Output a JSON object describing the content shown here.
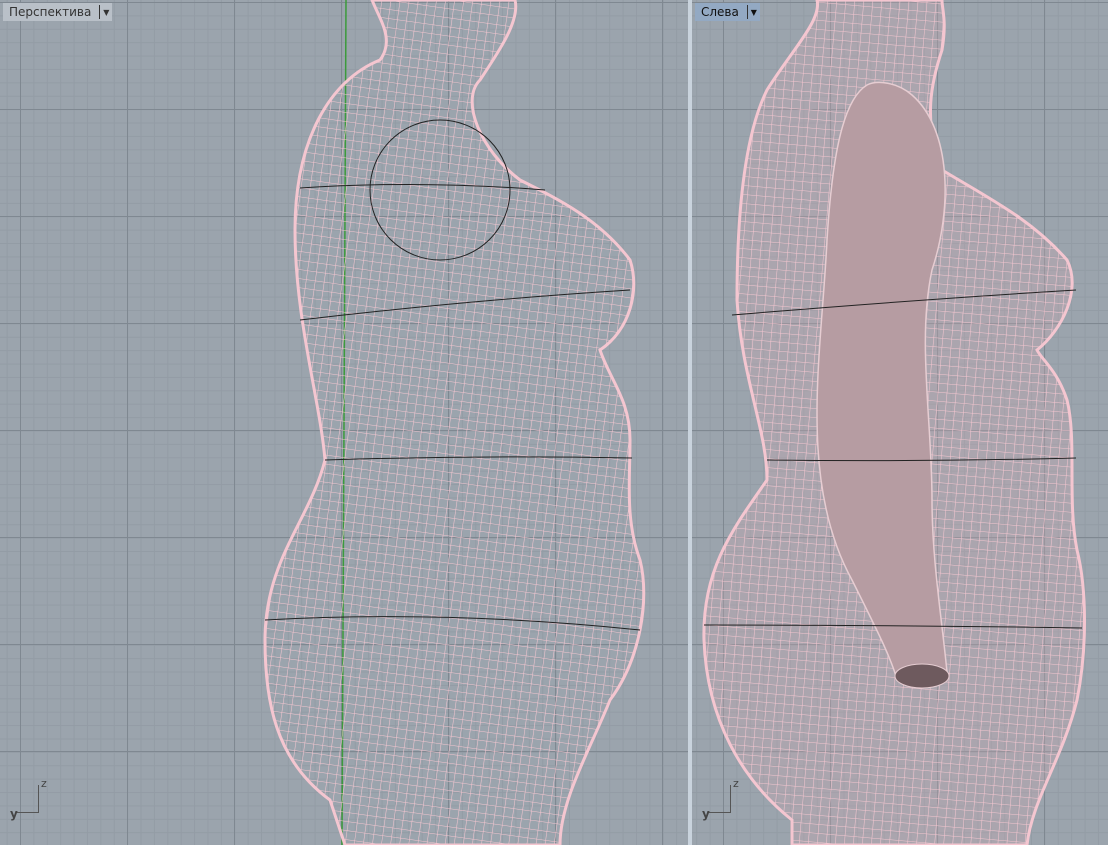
{
  "viewports": [
    {
      "title": "Перспектива",
      "axis_labels": {
        "z": "z",
        "y": "y"
      }
    },
    {
      "title": "Слева",
      "axis_labels": {
        "z": "z",
        "y": "y"
      }
    }
  ],
  "colors": {
    "wire": "#f4c6d0",
    "background": "#9ba4ad",
    "active_label": "#93a9c3",
    "axis_green": "#3c9a3c"
  }
}
